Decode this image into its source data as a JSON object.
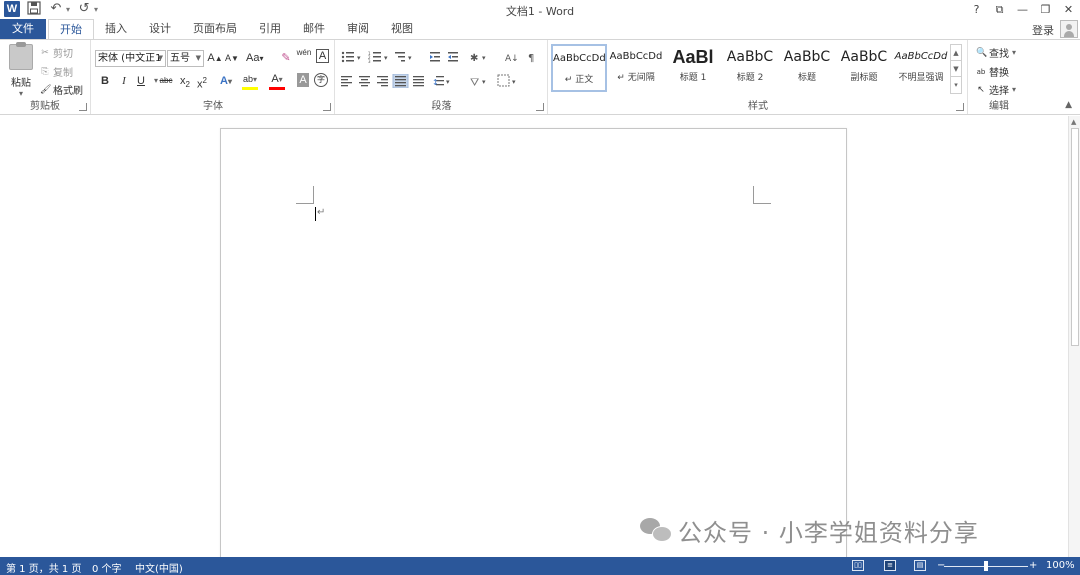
{
  "window": {
    "title": "文档1 - Word",
    "controls": [
      "?",
      "⧉",
      "—",
      "❐",
      "✕"
    ]
  },
  "qat": {
    "logo": "W",
    "save": "💾",
    "undo": "↶",
    "redo": "↺",
    "more": "▾"
  },
  "tabs": {
    "file": "文件",
    "items": [
      "开始",
      "插入",
      "设计",
      "页面布局",
      "引用",
      "邮件",
      "审阅",
      "视图"
    ],
    "active": "开始",
    "login": "登录"
  },
  "ribbon": {
    "clipboard": {
      "label": "剪贴板",
      "paste": "粘贴",
      "cut": "剪切",
      "copy": "复制",
      "format_painter": "格式刷"
    },
    "font": {
      "label": "字体",
      "font_name": "宋体 (中文正1",
      "font_size": "五号",
      "grow": "A",
      "shrink": "A",
      "case": "Aa",
      "clear": "✎",
      "phonetic": "wén",
      "border": "A",
      "bold": "B",
      "italic": "I",
      "underline": "U",
      "strike": "abc",
      "subscript": "x",
      "superscript": "x",
      "effects": "A",
      "highlight": "ab",
      "color": "A",
      "shade": "A",
      "enclose": "字"
    },
    "paragraph": {
      "label": "段落"
    },
    "styles": {
      "label": "样式",
      "items": [
        {
          "sample": "AaBbCcDd",
          "name": "↵ 正文"
        },
        {
          "sample": "AaBbCcDd",
          "name": "↵ 无间隔"
        },
        {
          "sample": "AaBl",
          "name": "标题 1"
        },
        {
          "sample": "AaBbC",
          "name": "标题 2"
        },
        {
          "sample": "AaBbC",
          "name": "标题"
        },
        {
          "sample": "AaBbC",
          "name": "副标题"
        },
        {
          "sample": "AaBbCcDd",
          "name": "不明显强调"
        }
      ]
    },
    "editing": {
      "label": "编辑",
      "find": "查找",
      "replace": "替换",
      "select": "选择"
    }
  },
  "document": {
    "para_mark": "↵"
  },
  "watermark": {
    "text": "公众号 · 小李学姐资料分享"
  },
  "statusbar": {
    "page": "第 1 页，共 1 页",
    "words": "0 个字",
    "lang": "中文(中国)",
    "zoom": "100%",
    "zoom_minus": "−",
    "zoom_plus": "+"
  },
  "colors": {
    "accent": "#2b579a",
    "highlight": "#ffff00",
    "font_color": "#ff0000"
  }
}
